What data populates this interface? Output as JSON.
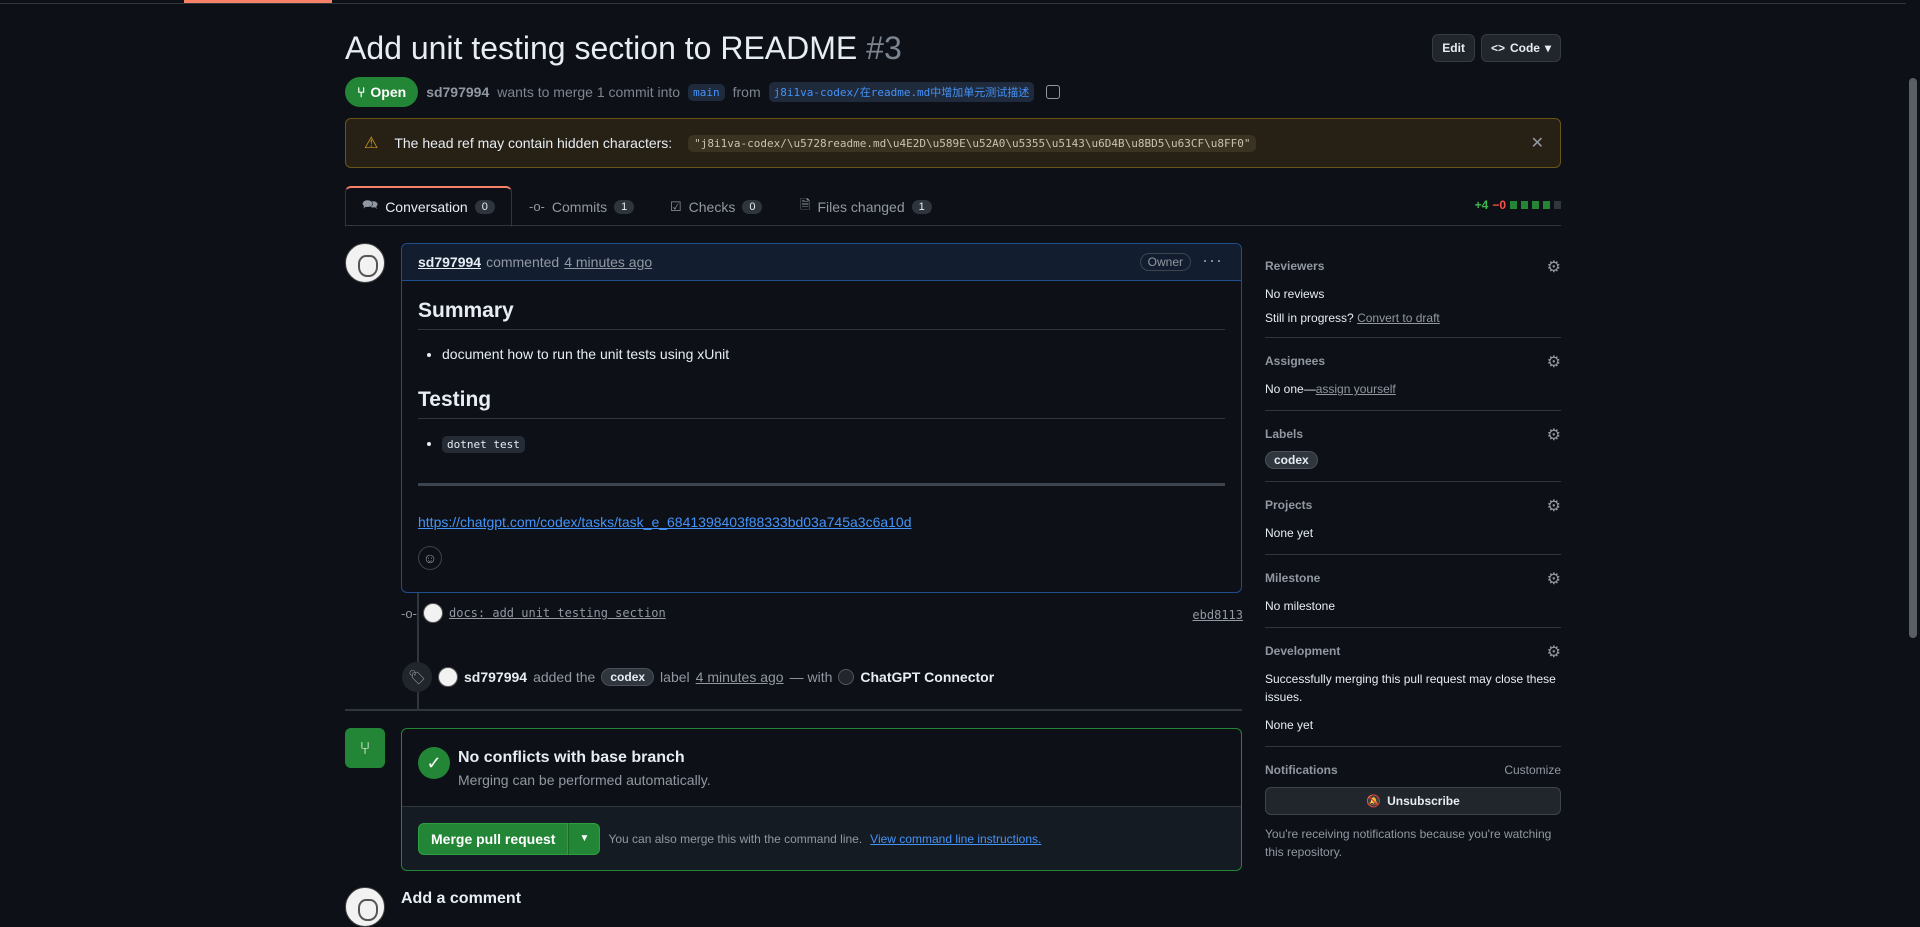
{
  "pr": {
    "title": "Add unit testing section to README",
    "number": "#3",
    "state": "Open",
    "author": "sd797994",
    "merge_text": "wants to merge 1 commit into",
    "base": "main",
    "from_text": "from",
    "head": "j8i1va-codex/在readme.md中增加单元测试描述"
  },
  "header": {
    "edit_label": "Edit",
    "code_label": "Code"
  },
  "warning": {
    "text": "The head ref may contain hidden characters:",
    "ref": "\"j8i1va-codex/\\u5728readme.md\\u4E2D\\u589E\\u52A0\\u5355\\u5143\\u6D4B\\u8BD5\\u63CF\\u8FF0\""
  },
  "tabs": [
    {
      "label": "Conversation",
      "count": "0"
    },
    {
      "label": "Commits",
      "count": "1"
    },
    {
      "label": "Checks",
      "count": "0"
    },
    {
      "label": "Files changed",
      "count": "1"
    }
  ],
  "diffstat": {
    "additions": "+4",
    "deletions": "−0"
  },
  "comment": {
    "author": "sd797994",
    "action": "commented",
    "time": "4 minutes ago",
    "role": "Owner",
    "h_summary": "Summary",
    "summary_item": "document how to run the unit tests using xUnit",
    "h_testing": "Testing",
    "testing_item": "dotnet test",
    "link": "https://chatgpt.com/codex/tasks/task_e_6841398403f88333bd03a745a3c6a10d"
  },
  "timeline": {
    "commit_msg": "docs: add unit testing section",
    "commit_sha": "ebd8113",
    "label_actor": "sd797994",
    "label_action": "added the",
    "label_name": "codex",
    "label_word": "label",
    "label_time": "4 minutes ago",
    "with_text": "— with",
    "connector": "ChatGPT Connector"
  },
  "merge": {
    "title": "No conflicts with base branch",
    "subtitle": "Merging can be performed automatically.",
    "button": "Merge pull request",
    "hint": "You can also merge this with the command line.",
    "hint_link": "View command line instructions."
  },
  "add_comment": "Add a comment",
  "sidebar": {
    "reviewers": {
      "title": "Reviewers",
      "value": "No reviews",
      "progress": "Still in progress?",
      "draft_link": "Convert to draft"
    },
    "assignees": {
      "title": "Assignees",
      "value": "No one—",
      "assign_link": "assign yourself"
    },
    "labels": {
      "title": "Labels",
      "label": "codex"
    },
    "projects": {
      "title": "Projects",
      "value": "None yet"
    },
    "milestone": {
      "title": "Milestone",
      "value": "No milestone"
    },
    "development": {
      "title": "Development",
      "desc": "Successfully merging this pull request may close these issues.",
      "value": "None yet"
    },
    "notifications": {
      "title": "Notifications",
      "customize": "Customize",
      "button": "Unsubscribe",
      "footer": "You're receiving notifications because you're watching this repository."
    }
  }
}
